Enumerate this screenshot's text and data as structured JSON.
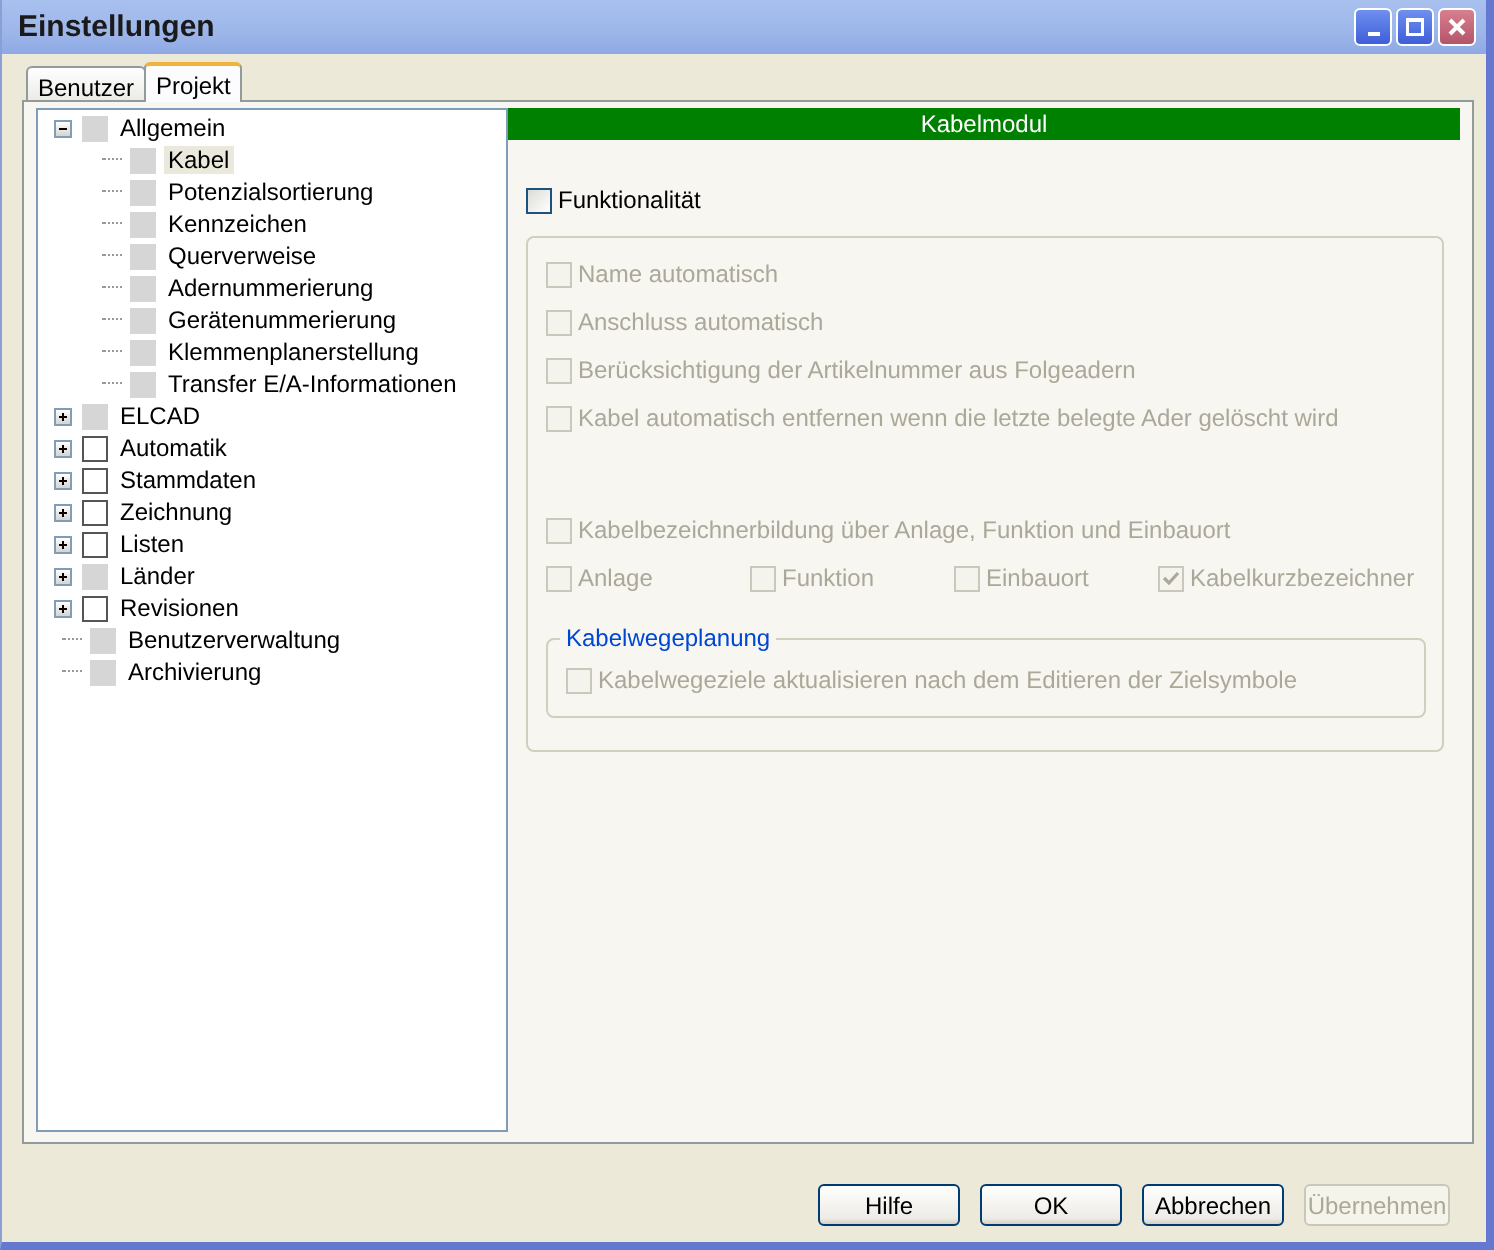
{
  "window": {
    "title": "Einstellungen"
  },
  "tabs": [
    {
      "label": "Benutzer",
      "selected": false
    },
    {
      "label": "Projekt",
      "selected": true
    }
  ],
  "tree": [
    {
      "label": "Allgemein",
      "disabled": true,
      "expanded": true,
      "selected": false,
      "children": [
        {
          "label": "Kabel",
          "disabled": true,
          "selected": true
        },
        {
          "label": "Potenzialsortierung",
          "disabled": true,
          "selected": false
        },
        {
          "label": "Kennzeichen",
          "disabled": true,
          "selected": false
        },
        {
          "label": "Querverweise",
          "disabled": true,
          "selected": false
        },
        {
          "label": "Adernummerierung",
          "disabled": true,
          "selected": false
        },
        {
          "label": "Gerätenummerierung",
          "disabled": true,
          "selected": false
        },
        {
          "label": "Klemmenplanerstellung",
          "disabled": true,
          "selected": false
        },
        {
          "label": "Transfer E/A-Informationen",
          "disabled": true,
          "selected": false
        }
      ]
    },
    {
      "label": "ELCAD",
      "disabled": true,
      "expanded": false,
      "selected": false
    },
    {
      "label": "Automatik",
      "disabled": false,
      "expanded": false,
      "selected": false
    },
    {
      "label": "Stammdaten",
      "disabled": false,
      "expanded": false,
      "selected": false
    },
    {
      "label": "Zeichnung",
      "disabled": false,
      "expanded": false,
      "selected": false
    },
    {
      "label": "Listen",
      "disabled": false,
      "expanded": false,
      "selected": false
    },
    {
      "label": "Länder",
      "disabled": true,
      "expanded": false,
      "selected": false
    },
    {
      "label": "Revisionen",
      "disabled": false,
      "expanded": false,
      "selected": false
    },
    {
      "label": "Benutzerverwaltung",
      "disabled": true,
      "selected": false
    },
    {
      "label": "Archivierung",
      "disabled": true,
      "selected": false
    }
  ],
  "panel": {
    "header": "Kabelmodul",
    "main_option": {
      "label": "Funktionalität",
      "checked": false,
      "disabled": false
    },
    "options": [
      {
        "label": "Name automatisch",
        "checked": false,
        "disabled": true
      },
      {
        "label": "Anschluss automatisch",
        "checked": false,
        "disabled": true
      },
      {
        "label": "Berücksichtigung der Artikelnummer aus Folgeadern",
        "checked": false,
        "disabled": true
      },
      {
        "label": "Kabel automatisch entfernen wenn die letzte belegte Ader gelöscht wird",
        "checked": false,
        "disabled": true
      }
    ],
    "naming_option": {
      "label": "Kabelbezeichnerbildung über Anlage, Funktion und Einbauort",
      "checked": false,
      "disabled": true
    },
    "naming_parts": [
      {
        "label": "Anlage",
        "checked": false,
        "disabled": true
      },
      {
        "label": "Funktion",
        "checked": false,
        "disabled": true
      },
      {
        "label": "Einbauort",
        "checked": false,
        "disabled": true
      },
      {
        "label": "Kabelkurzbezeichner",
        "checked": true,
        "disabled": true
      }
    ],
    "subgroup": {
      "title": "Kabelwegeplanung",
      "options": [
        {
          "label": "Kabelwegeziele aktualisieren nach dem Editieren der Zielsymbole",
          "checked": false,
          "disabled": true
        }
      ]
    }
  },
  "buttons": [
    {
      "label": "Hilfe",
      "disabled": false
    },
    {
      "label": "OK",
      "disabled": false
    },
    {
      "label": "Abbrechen",
      "disabled": false
    },
    {
      "label": "Übernehmen",
      "disabled": true
    }
  ]
}
